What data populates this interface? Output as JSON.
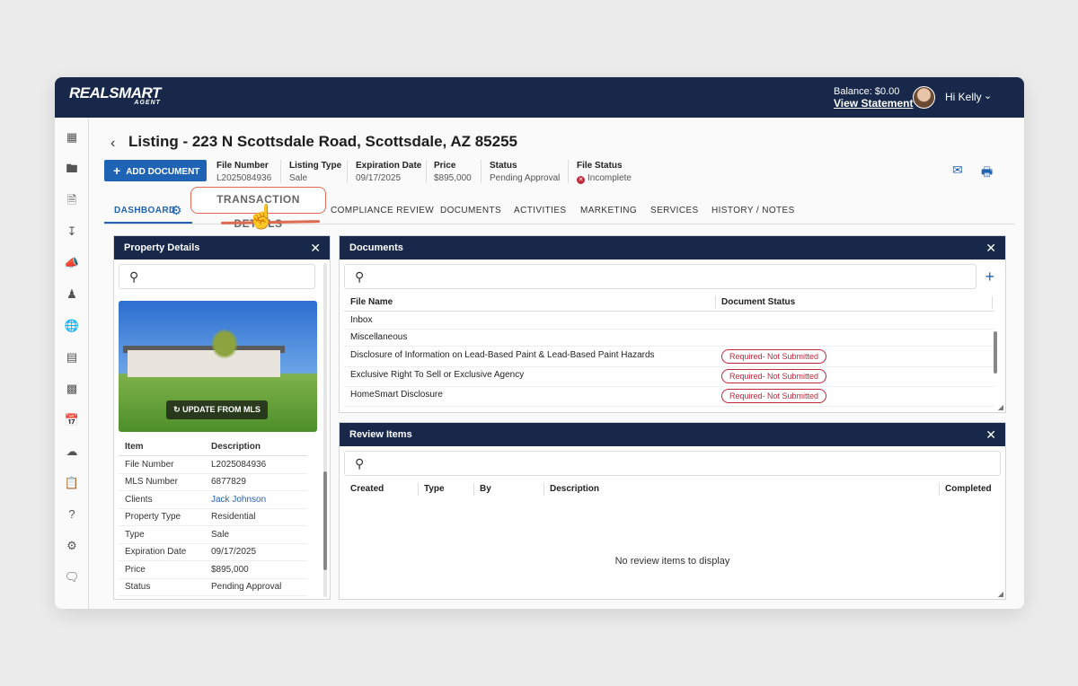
{
  "header": {
    "logo_main": "REALSMART",
    "logo_sub": "AGENT",
    "balance": "Balance: $0.00",
    "view_statement": "View Statement",
    "greeting": "Hi Kelly"
  },
  "page": {
    "title": "Listing - 223 N Scottsdale Road, Scottsdale, AZ 85255",
    "add_document": "ADD DOCUMENT"
  },
  "meta": {
    "file_number_label": "File Number",
    "file_number": "L2025084936",
    "listing_type_label": "Listing Type",
    "listing_type": "Sale",
    "expiration_label": "Expiration Date",
    "expiration": "09/17/2025",
    "price_label": "Price",
    "price": "$895,000",
    "status_label": "Status",
    "status": "Pending Approval",
    "file_status_label": "File Status",
    "file_status": "Incomplete"
  },
  "tabs": [
    "DASHBOARD",
    "TRANSACTION DETAILS",
    "COMPLIANCE REVIEW",
    "DOCUMENTS",
    "ACTIVITIES",
    "MARKETING",
    "SERVICES",
    "HISTORY / NOTES"
  ],
  "property_panel": {
    "title": "Property Details",
    "update_button": "UPDATE FROM MLS",
    "header_item": "Item",
    "header_description": "Description",
    "rows": [
      {
        "k": "File Number",
        "v": "L2025084936"
      },
      {
        "k": "MLS Number",
        "v": "6877829"
      },
      {
        "k": "Clients",
        "v": "Jack Johnson"
      },
      {
        "k": "Property Type",
        "v": "Residential"
      },
      {
        "k": "Type",
        "v": "Sale"
      },
      {
        "k": "Expiration Date",
        "v": "09/17/2025"
      },
      {
        "k": "Price",
        "v": "$895,000"
      },
      {
        "k": "Status",
        "v": "Pending Approval"
      }
    ]
  },
  "documents_panel": {
    "title": "Documents",
    "col_file_name": "File Name",
    "col_status": "Document Status",
    "rows": [
      {
        "name": "Inbox",
        "status": ""
      },
      {
        "name": "Miscellaneous",
        "status": ""
      },
      {
        "name": "Disclosure of Information on Lead-Based Paint & Lead-Based Paint Hazards",
        "status": "Required- Not Submitted"
      },
      {
        "name": "Exclusive Right To Sell or Exclusive Agency",
        "status": "Required- Not Submitted"
      },
      {
        "name": "HomeSmart Disclosure",
        "status": "Required- Not Submitted"
      }
    ]
  },
  "review_panel": {
    "title": "Review Items",
    "columns": [
      "Created",
      "Type",
      "By",
      "Description",
      "Completed"
    ],
    "empty": "No review items to display"
  },
  "colors": {
    "navy": "#17284a",
    "accent": "#1f63b5",
    "required": "#c2273a",
    "highlight": "#e06a4f"
  }
}
